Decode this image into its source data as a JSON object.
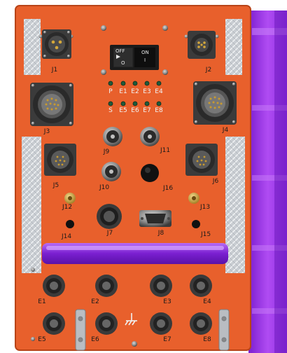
{
  "panel": {
    "connector_labels": {
      "j1": "J1",
      "j2": "J2",
      "j3": "J3",
      "j4": "J4",
      "j5": "J5",
      "j6": "J6",
      "j7": "J7",
      "j8": "J8",
      "j9": "J9",
      "j10": "J10",
      "j11": "J11",
      "j12": "J12",
      "j13": "J13",
      "j14": "J14",
      "j15": "J15",
      "j16": "J16"
    },
    "encoder_labels": {
      "e1": "E1",
      "e2": "E2",
      "e3": "E3",
      "e4": "E4",
      "e5": "E5",
      "e6": "E6",
      "e7": "E7",
      "e8": "E8"
    },
    "led_labels": {
      "p": "P",
      "e1": "E1",
      "e2": "E2",
      "e3": "E3",
      "e4": "E4",
      "s": "S",
      "e5": "E5",
      "e6": "E6",
      "e7": "E7",
      "e8": "E8"
    },
    "power_switch": {
      "off_label": "OFF",
      "on_label": "ON",
      "off_symbol": "O",
      "on_symbol": "I"
    },
    "colors": {
      "panel": "#e8602c",
      "handle": "#8a2be2",
      "heatsink": "#9b30e0",
      "reflective_tape": "#c8ccd0"
    },
    "icons": {
      "ground": "ground-icon"
    }
  }
}
